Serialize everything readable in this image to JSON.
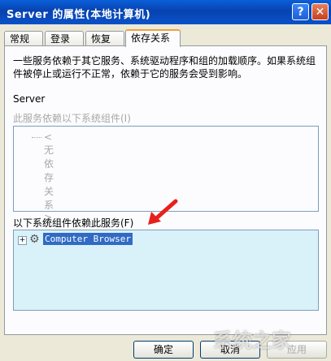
{
  "window": {
    "title": "Server 的属性(本地计算机)",
    "help_label": "?",
    "close_label": "✕"
  },
  "tabs": [
    {
      "label": "常规"
    },
    {
      "label": "登录"
    },
    {
      "label": "恢复"
    },
    {
      "label": "依存关系"
    }
  ],
  "dependencies": {
    "description": "一些服务依赖于其它服务、系统驱动程序和组的加载顺序。如果系统组件被停止或运行不正常，依赖于它的服务会受到影响。",
    "service_name": "Server",
    "depends_on_label": "此服务依赖以下系统组件(I)",
    "depends_on_items": [
      "<无依存关系>"
    ],
    "dependents_label": "以下系统组件依赖此服务(F)",
    "dependents_items": [
      "Computer Browser"
    ]
  },
  "buttons": {
    "ok": "确定",
    "cancel": "取消",
    "apply": "应用"
  },
  "watermark": "系统之家",
  "colors": {
    "titlebar": "#0842b0",
    "selection": "#316ac5",
    "arrow": "#e8201b",
    "list_bg": "#d9f2fa"
  }
}
